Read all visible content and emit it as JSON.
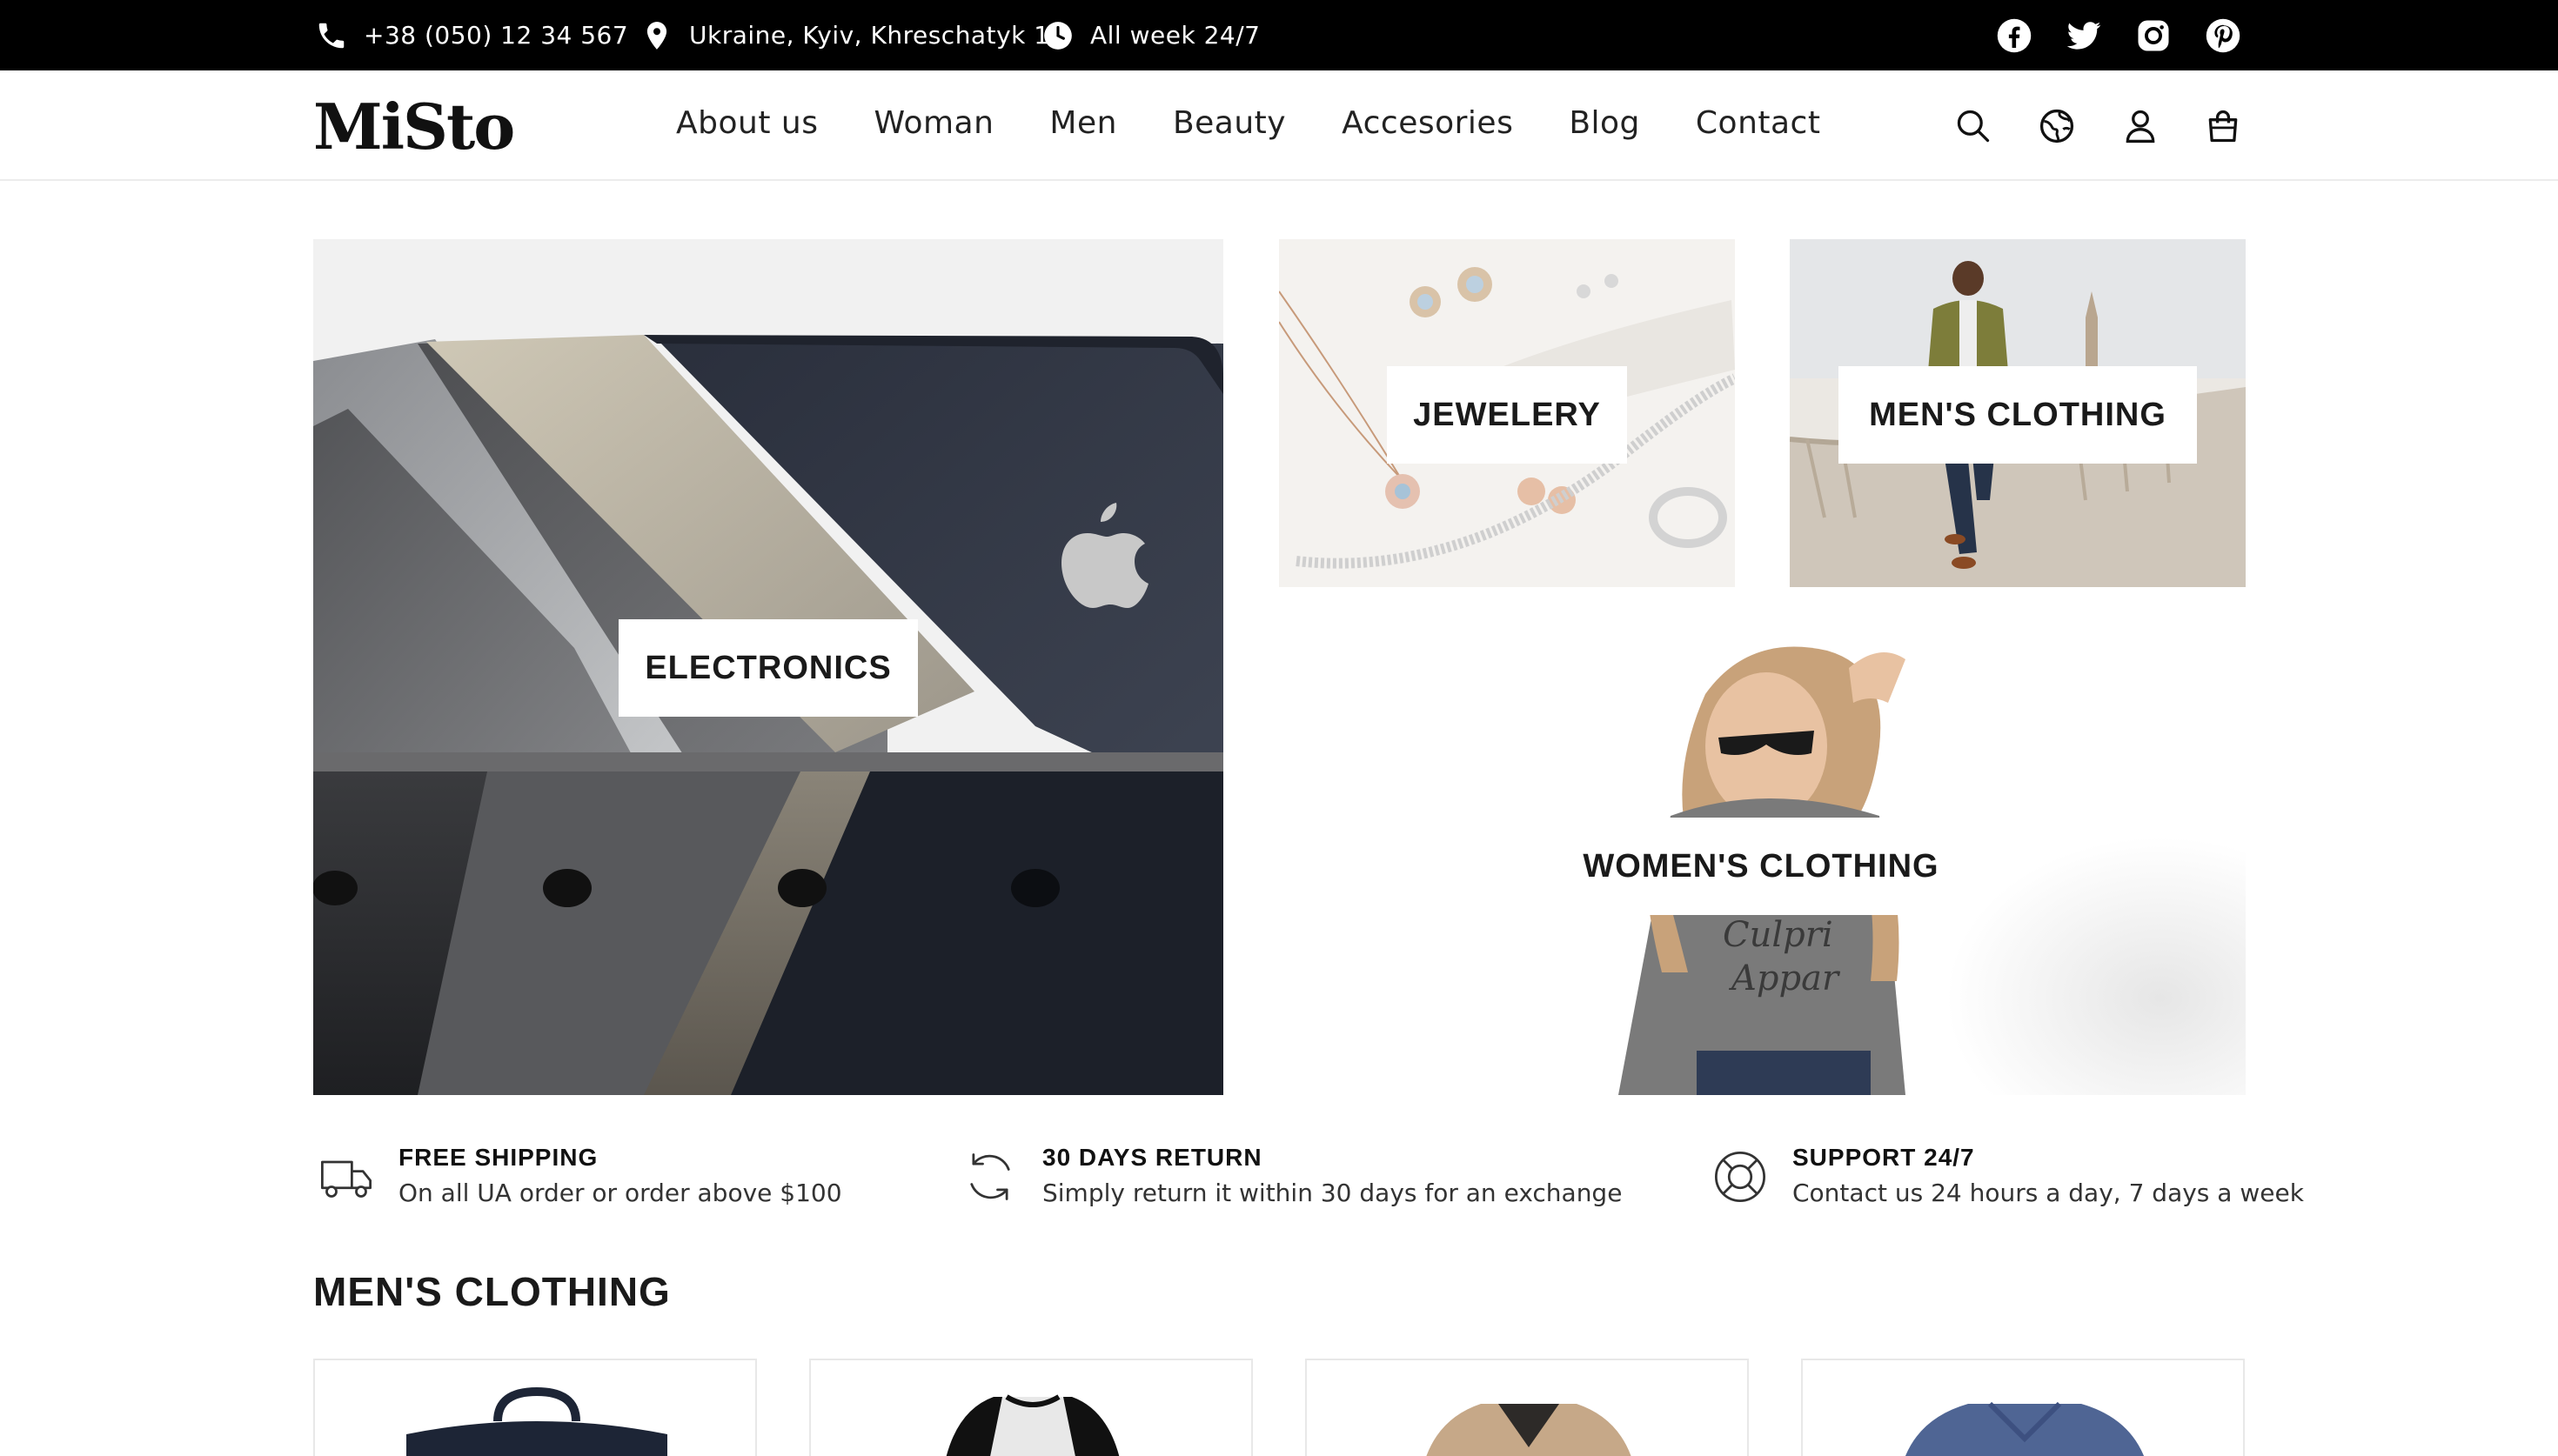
{
  "topbar": {
    "phone": "+38 (050) 12 34 567",
    "address": "Ukraine, Kyiv, Khreschatyk 1",
    "hours": "All week 24/7",
    "icons": {
      "phone": "phone-icon",
      "location": "location-pin-icon",
      "clock": "clock-icon"
    },
    "social": [
      "facebook-icon",
      "twitter-icon",
      "instagram-icon",
      "pinterest-icon"
    ]
  },
  "header": {
    "logo": "MiSto",
    "nav": [
      "About us",
      "Woman",
      "Men",
      "Beauty",
      "Accesories",
      "Blog",
      "Contact"
    ],
    "icons": [
      "search-icon",
      "globe-icon",
      "user-icon",
      "shopping-bag-icon"
    ]
  },
  "hero": {
    "electronics": "ELECTRONICS",
    "jewelery": "JEWELERY",
    "mens": "MEN'S CLOTHING",
    "womens": "WOMEN'S CLOTHING"
  },
  "features": [
    {
      "icon": "truck-icon",
      "title": "FREE SHIPPING",
      "subtitle": "On all UA order or order above $100"
    },
    {
      "icon": "return-arrows-icon",
      "title": "30 DAYS RETURN",
      "subtitle": "Simply return it within 30 days for an exchange"
    },
    {
      "icon": "lifebuoy-icon",
      "title": "SUPPORT 24/7",
      "subtitle": "Contact us 24 hours a day, 7 days a week"
    }
  ],
  "section": {
    "title": "MEN'S CLOTHING"
  },
  "colors": {
    "topbar": "#000000",
    "text": "#111111",
    "border": "#e8e8e8"
  }
}
